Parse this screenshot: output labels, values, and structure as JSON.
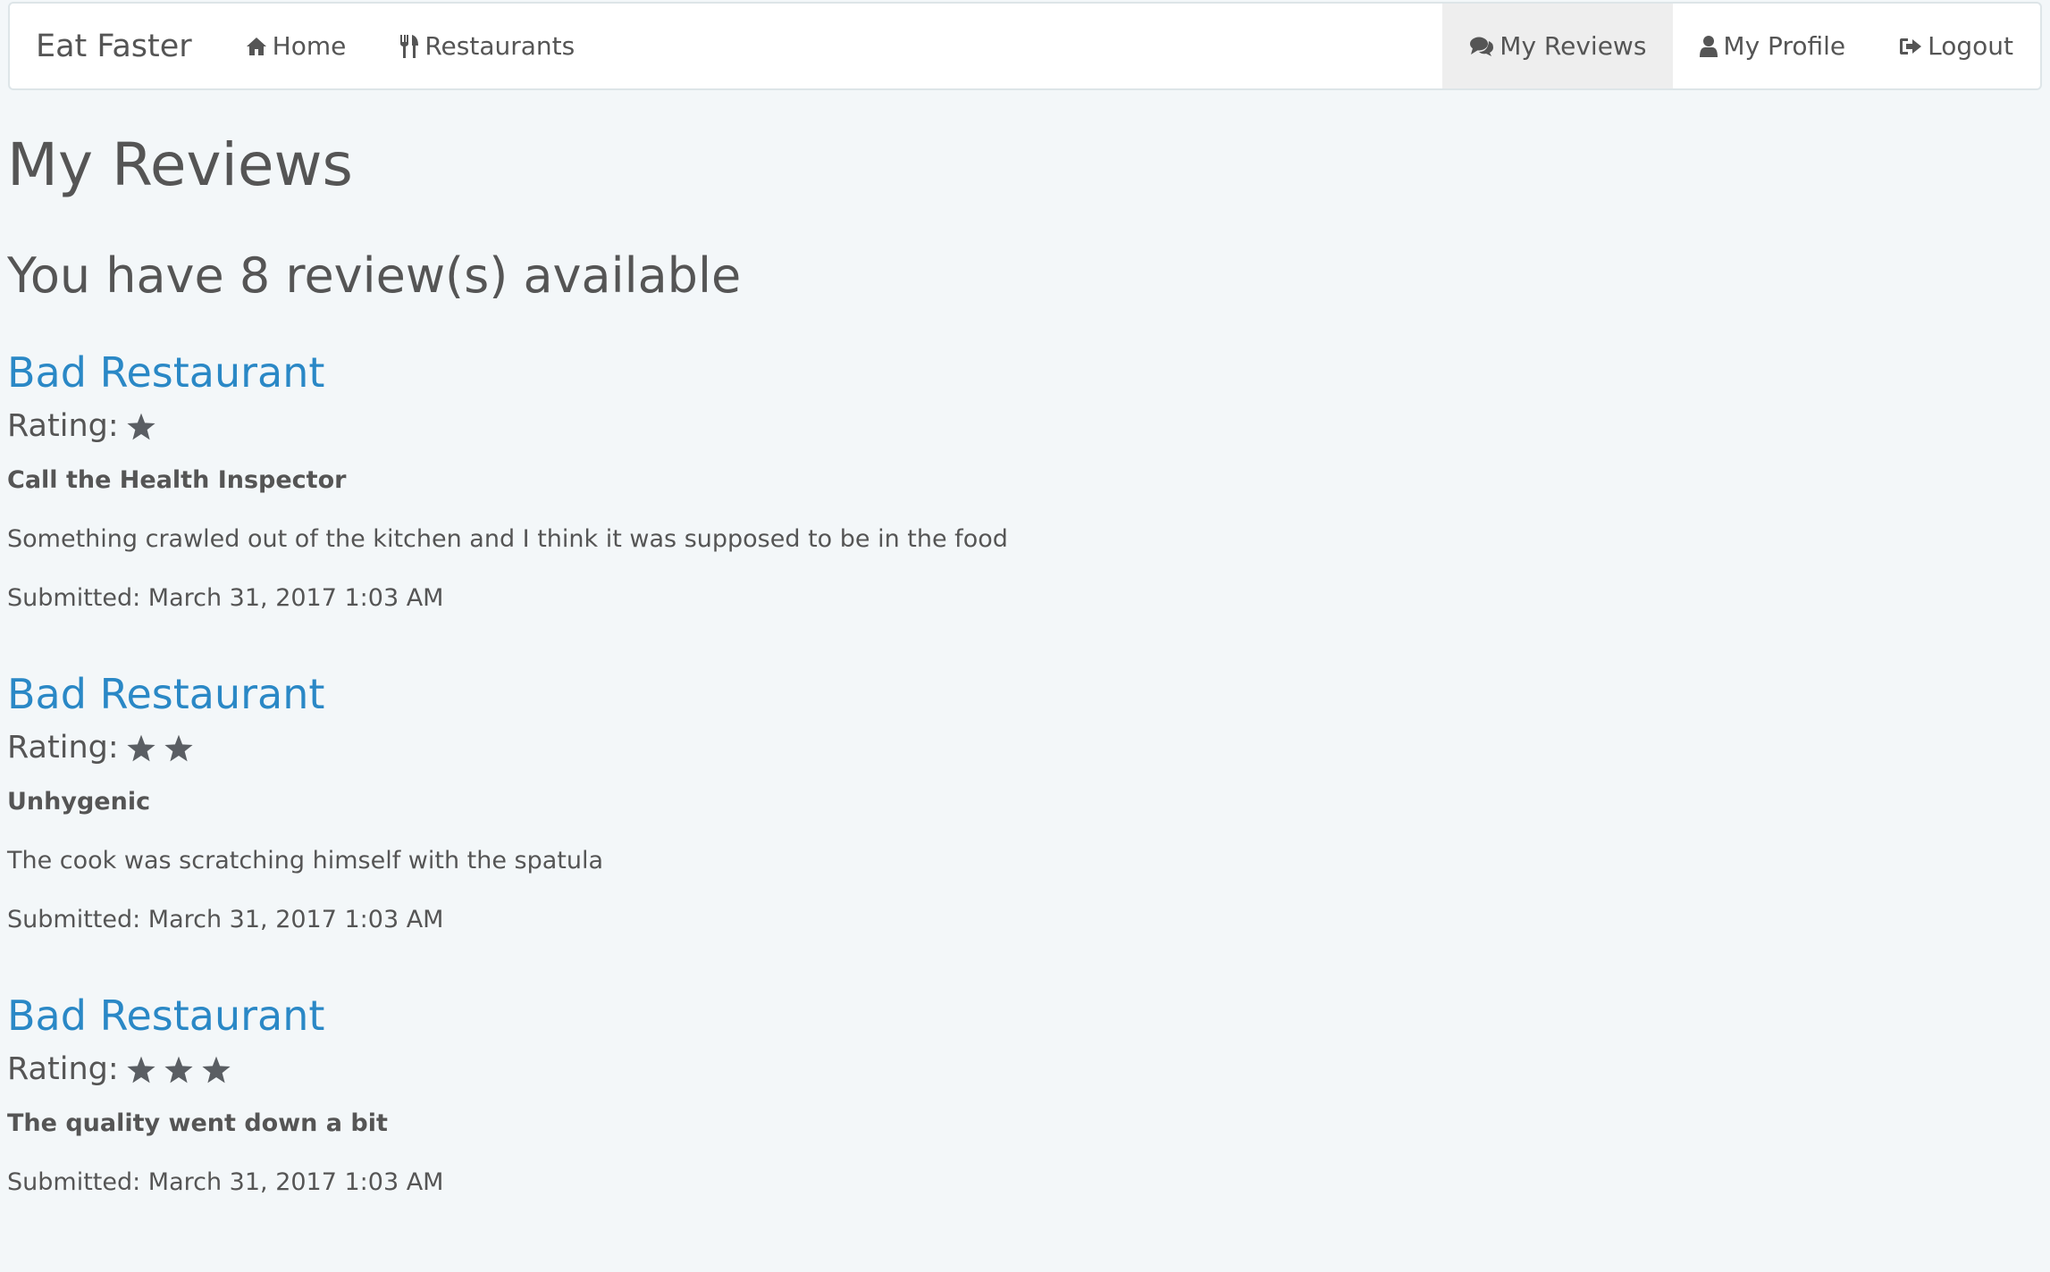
{
  "app": {
    "brand": "Eat Faster"
  },
  "nav": {
    "left": [
      {
        "label": "Home",
        "icon": "home-icon"
      },
      {
        "label": "Restaurants",
        "icon": "cutlery-icon"
      }
    ],
    "right": [
      {
        "label": "My Reviews",
        "icon": "comments-icon",
        "active": true
      },
      {
        "label": "My Profile",
        "icon": "user-icon",
        "active": false
      },
      {
        "label": "Logout",
        "icon": "logout-icon",
        "active": false
      }
    ]
  },
  "page": {
    "title": "My Reviews",
    "summary": "You have 8 review(s) available"
  },
  "rating_label": "Rating:",
  "reviews": [
    {
      "restaurant": "Bad Restaurant",
      "rating": 1,
      "heading": "Call the Health Inspector",
      "body": "Something crawled out of the kitchen and I think it was supposed to be in the food",
      "submitted": "Submitted: March 31, 2017 1:03 AM"
    },
    {
      "restaurant": "Bad Restaurant",
      "rating": 2,
      "heading": "Unhygenic",
      "body": "The cook was scratching himself with the spatula",
      "submitted": "Submitted: March 31, 2017 1:03 AM"
    },
    {
      "restaurant": "Bad Restaurant",
      "rating": 3,
      "heading": "The quality went down a bit",
      "body": "",
      "submitted": "Submitted: March 31, 2017 1:03 AM"
    }
  ],
  "colors": {
    "background": "#f3f7f9",
    "link": "#2a88c6",
    "text": "#555555",
    "active_nav": "#eeeeee",
    "star": "#5a5e63"
  }
}
